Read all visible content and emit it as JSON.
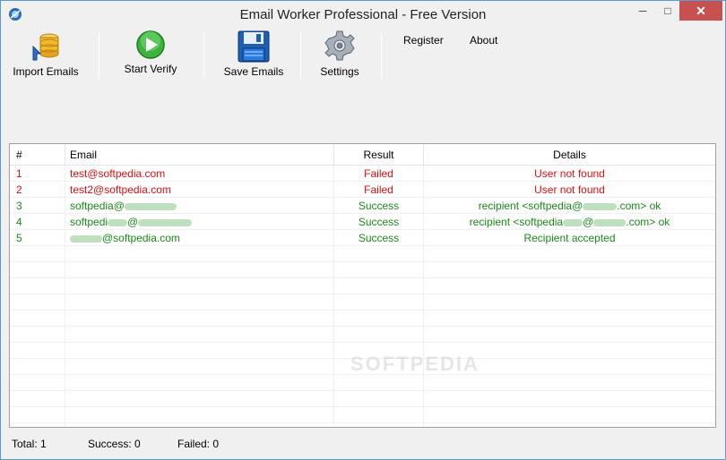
{
  "window": {
    "title": "Email Worker Professional - Free Version",
    "min": "─",
    "max": "□",
    "close": "✕"
  },
  "toolbar": {
    "import_label": "Import Emails",
    "verify_label": "Start Verify",
    "save_label": "Save Emails",
    "settings_label": "Settings"
  },
  "menu": {
    "register": "Register",
    "about": "About"
  },
  "grid": {
    "headers": {
      "num": "#",
      "email": "Email",
      "result": "Result",
      "details": "Details"
    },
    "rows": [
      {
        "num": "1",
        "email": "test@softpedia.com",
        "result": "Failed",
        "details": "User not found",
        "status": "failed"
      },
      {
        "num": "2",
        "email": "test2@softpedia.com",
        "result": "Failed",
        "details": "User not found",
        "status": "failed"
      },
      {
        "num": "3",
        "email_prefix": "softpedia@",
        "result": "Success",
        "details_prefix": "recipient <softpedia@",
        "details_suffix": ".com> ok",
        "status": "success"
      },
      {
        "num": "4",
        "email_prefix": "softpedi",
        "email_mid": "@",
        "result": "Success",
        "details_prefix": "recipient <softpedia",
        "details_mid": "@",
        "details_suffix": ".com> ok",
        "status": "success"
      },
      {
        "num": "5",
        "email_suffix": "@softpedia.com",
        "result": "Success",
        "details": "Recipient accepted",
        "status": "success"
      }
    ]
  },
  "status": {
    "total": "Total: 1",
    "success": "Success: 0",
    "failed": "Failed: 0"
  },
  "watermark": "SOFTPEDIA",
  "colors": {
    "failed": "#e01010",
    "success": "#1a8a1a",
    "frame": "#5a9bd5"
  }
}
